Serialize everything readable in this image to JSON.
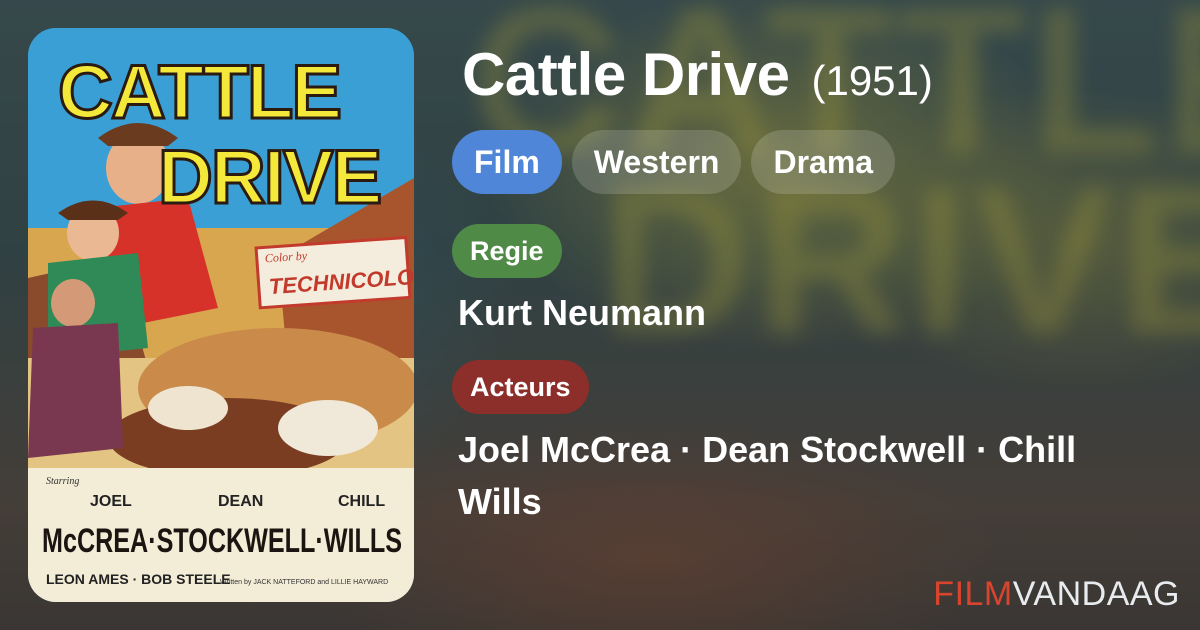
{
  "movie": {
    "title": "Cattle Drive",
    "year": "(1951)"
  },
  "tags": [
    "Film",
    "Western",
    "Drama"
  ],
  "director": {
    "label": "Regie",
    "value": "Kurt Neumann"
  },
  "actors": {
    "label": "Acteurs",
    "value": "Joel McCrea · Dean Stockwell · Chill Wills"
  },
  "poster": {
    "title_line1": "CATTLE",
    "title_line2": "DRIVE",
    "color_by": "Color by",
    "technicolor": "TECHNICOLOR",
    "starring": "Starring",
    "first_names": [
      "JOEL",
      "DEAN",
      "CHILL"
    ],
    "last_names": "McCREA·STOCKWELL·WILLS",
    "supporting": "LEON AMES · BOB STEELE",
    "written_by": "Written by JACK NATTEFORD and LILLIE HAYWARD"
  },
  "branding": {
    "logo_part1": "FILM",
    "logo_part2": "VANDAAG"
  },
  "colors": {
    "film_chip": "#4f86d8",
    "regie_badge": "#4f8a47",
    "acteurs_badge": "#8c2e2a",
    "logo_accent": "#d9442e"
  }
}
